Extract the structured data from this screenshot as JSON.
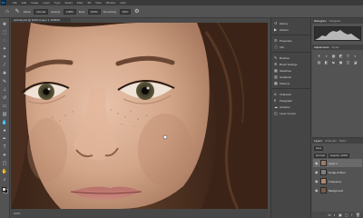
{
  "app": {
    "logo": "Ps"
  },
  "menu": [
    "File",
    "Edit",
    "Image",
    "Layer",
    "Type",
    "Select",
    "Filter",
    "3D",
    "View",
    "Window",
    "Help"
  ],
  "options": {
    "mode_label": "Mode:",
    "mode_value": "Normal",
    "opacity_label": "Opacity:",
    "opacity_value": "100%",
    "flow_label": "Flow:",
    "flow_value": "100%",
    "smoothing_label": "Smoothing:",
    "smoothing_value": "10%"
  },
  "document": {
    "tab_label": "portrait.psd @ 100% (Layer 1, RGB/8)"
  },
  "status": {
    "zoom": "100%"
  },
  "strip": {
    "items": [
      {
        "icon": "history-icon",
        "label": "History"
      },
      {
        "icon": "actions-icon",
        "label": "Actions"
      },
      {
        "icon": "properties-icon",
        "label": "Properties"
      },
      {
        "icon": "info-icon",
        "label": "Info"
      },
      {
        "icon": "brush-icon",
        "label": "Brushes"
      },
      {
        "icon": "brush-settings-icon",
        "label": "Brush Settings"
      },
      {
        "icon": "swatches-icon",
        "label": "Swatches"
      },
      {
        "icon": "gradients-icon",
        "label": "Gradients"
      },
      {
        "icon": "patterns-icon",
        "label": "Patterns"
      },
      {
        "icon": "character-icon",
        "label": "Character"
      },
      {
        "icon": "paragraph-icon",
        "label": "Paragraph"
      },
      {
        "icon": "libraries-icon",
        "label": "Libraries"
      },
      {
        "icon": "adjustments-icon",
        "label": "Layer Comps"
      }
    ]
  },
  "panels": {
    "top_tabs": [
      "Histogram",
      "Navigator"
    ],
    "adj_tabs": [
      "Adjustments",
      "Styles"
    ],
    "adj_icons": [
      "☀",
      "◑",
      "▦",
      "◩",
      "▽",
      "◐",
      "▤",
      "◧",
      "☯",
      "▣",
      "◫",
      "◪"
    ],
    "layer_tabs": [
      "Layers",
      "Channels",
      "Paths"
    ],
    "kind_label": "Kind",
    "blend_mode": "Normal",
    "opacity_label": "Opacity: 100%",
    "layers": [
      {
        "name": "Layer 1",
        "thumb": "#9c7a63",
        "selected": true
      },
      {
        "name": "Dodge & Burn",
        "thumb": "#7f7f7f",
        "selected": false
      },
      {
        "name": "Frequency",
        "thumb": "#b08a70",
        "selected": false
      },
      {
        "name": "Background",
        "thumb": "#7a5a46",
        "selected": false
      }
    ],
    "footer_icons": [
      "fx",
      "◐",
      "▣",
      "▢",
      "+",
      "🗑"
    ]
  }
}
